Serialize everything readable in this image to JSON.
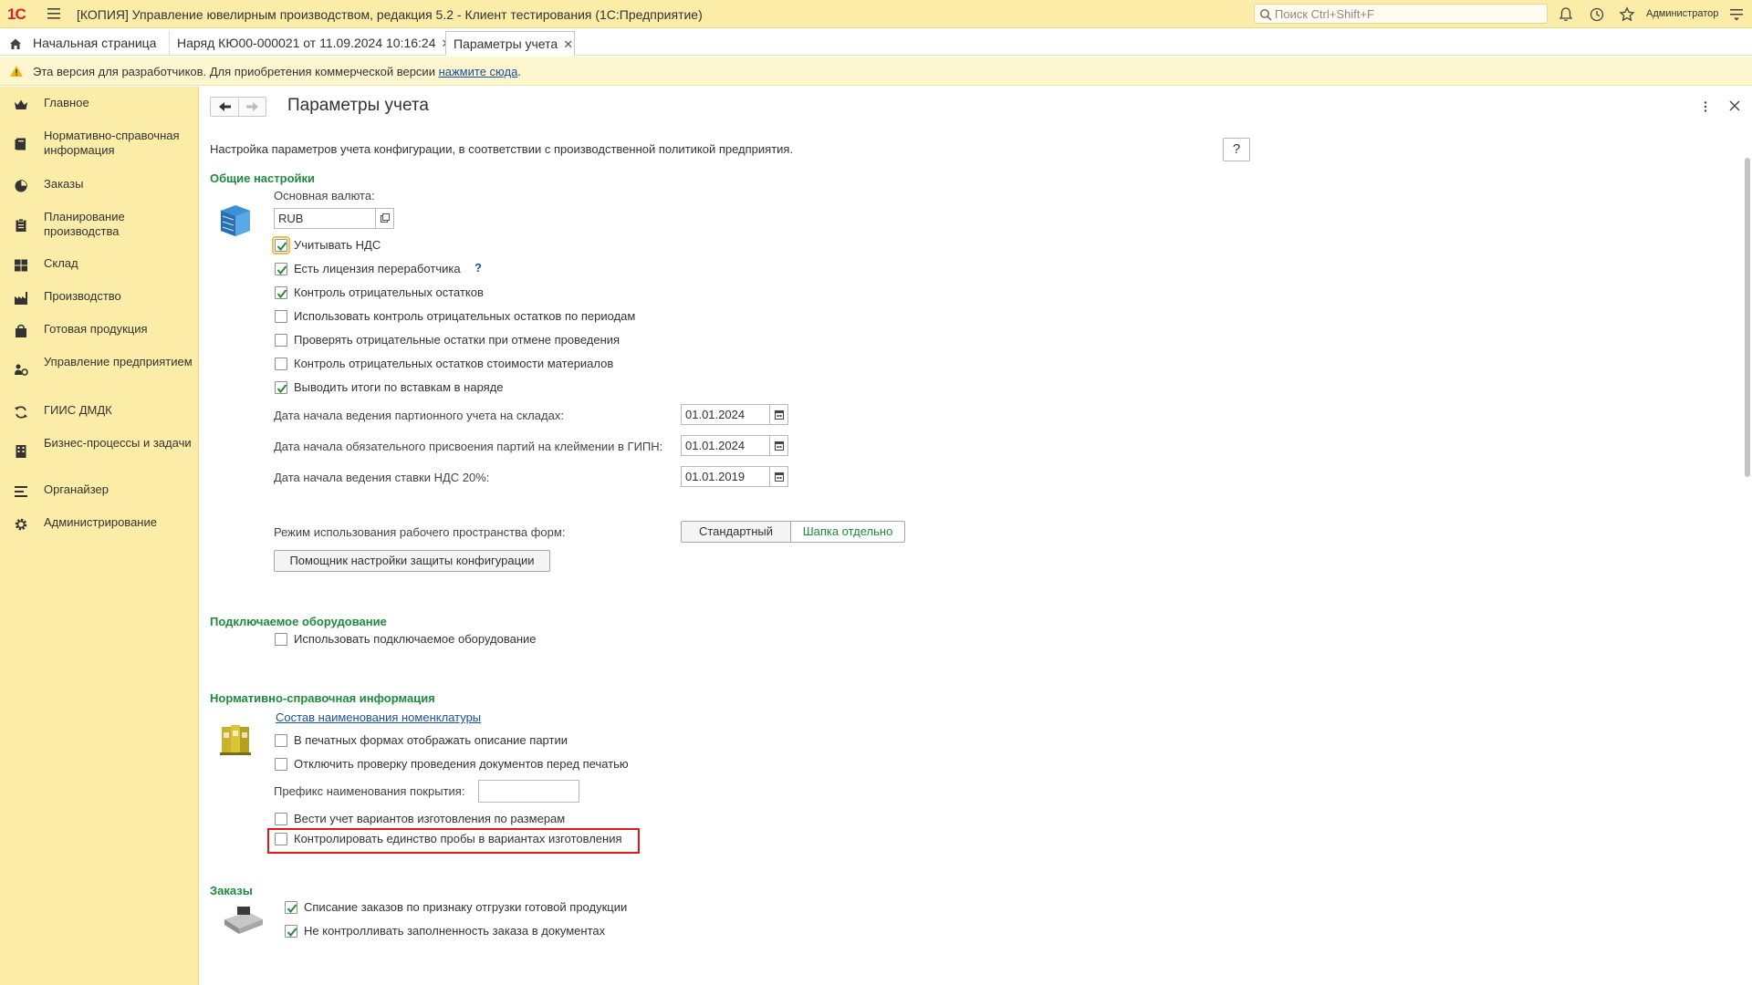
{
  "titlebar": {
    "logo": "1С",
    "app_title": "[КОПИЯ] Управление ювелирным производством, редакция 5.2  - Клиент тестирования (1С:Предприятие)",
    "search_placeholder": "Поиск Ctrl+Shift+F",
    "user": "Администратор"
  },
  "tabs": [
    {
      "label": "Начальная страница"
    },
    {
      "label": "Наряд КЮ00-000021 от 11.09.2024 10:16:24"
    },
    {
      "label": "Параметры учета"
    }
  ],
  "notice": {
    "text": "Эта версия для разработчиков. Для приобретения коммерческой версии ",
    "link": "нажмите сюда",
    "suffix": "."
  },
  "sidebar": {
    "items": [
      {
        "label": "Главное",
        "icon": "crown-icon"
      },
      {
        "label": "Нормативно-справочная информация",
        "icon": "book-icon"
      },
      {
        "label": "Заказы",
        "icon": "pie-chart-icon"
      },
      {
        "label": "Планирование производства",
        "icon": "clipboard-icon"
      },
      {
        "label": "Склад",
        "icon": "grid-icon"
      },
      {
        "label": "Производство",
        "icon": "factory-icon"
      },
      {
        "label": "Готовая продукция",
        "icon": "bag-icon"
      },
      {
        "label": "Управление предприятием",
        "icon": "people-gear-icon"
      },
      {
        "label": "ГИИС ДМДК",
        "icon": "sync-icon"
      },
      {
        "label": "Бизнес-процессы и задачи",
        "icon": "building-icon"
      },
      {
        "label": "Органайзер",
        "icon": "list-icon"
      },
      {
        "label": "Администрирование",
        "icon": "gear-icon"
      }
    ]
  },
  "page": {
    "title": "Параметры учета",
    "description": "Настройка параметров учета конфигурации, в соответствии с производственной политикой предприятия.",
    "help": "?"
  },
  "general": {
    "title": "Общие настройки",
    "currency_label": "Основная валюта:",
    "currency_value": "RUB",
    "checkboxes": [
      {
        "label": "Учитывать НДС",
        "checked": true
      },
      {
        "label": "Есть лицензия переработчика",
        "checked": true
      },
      {
        "label": "Контроль отрицательных остатков",
        "checked": true
      },
      {
        "label": "Использовать контроль отрицательных остатков по периодам",
        "checked": false
      },
      {
        "label": "Проверять отрицательные остатки при отмене проведения",
        "checked": false
      },
      {
        "label": "Контроль отрицательных остатков стоимости материалов",
        "checked": false
      },
      {
        "label": "Выводить итоги по вставкам в наряде",
        "checked": true
      }
    ],
    "license_help": "?",
    "dates": [
      {
        "label": "Дата начала ведения партионного учета на складах:",
        "value": "01.01.2024"
      },
      {
        "label": "Дата начала обязательного присвоения партий на клеймении в ГИПН:",
        "value": "01.01.2024"
      },
      {
        "label": "Дата начала ведения ставки НДС 20%:",
        "value": "01.01.2019"
      }
    ],
    "workspace_label": "Режим использования рабочего пространства форм:",
    "workspace_options": [
      "Стандартный",
      "Шапка отдельно"
    ],
    "workspace_selected": "Шапка отдельно",
    "protection_button": "Помощник настройки защиты конфигурации"
  },
  "equipment": {
    "title": "Подключаемое оборудование",
    "checkbox": {
      "label": "Использовать подключаемое оборудование",
      "checked": false
    }
  },
  "nsi": {
    "title": "Нормативно-справочная информация",
    "link": "Состав наименования номенклатуры",
    "checkboxes": [
      {
        "label": "В печатных формах отображать описание партии",
        "checked": false
      },
      {
        "label": "Отключить проверку проведения документов перед печатью",
        "checked": false
      }
    ],
    "prefix_label": "Префикс наименования покрытия:",
    "prefix_value": "",
    "checkboxes2": [
      {
        "label": "Вести учет вариантов изготовления по размерам",
        "checked": false
      },
      {
        "label": "Контролировать единство пробы в вариантах изготовления",
        "checked": false
      }
    ]
  },
  "orders": {
    "title": "Заказы",
    "checkboxes": [
      {
        "label": "Списание заказов по признаку отгрузки готовой продукции",
        "checked": true
      },
      {
        "label": "Не контролливать заполненность заказа в документах",
        "checked": true
      }
    ]
  },
  "colors": {
    "accent_green": "#1d8a3e",
    "panel_yellow": "#fbeca7",
    "highlight_red": "#e01818",
    "link_blue": "#1a4f9c"
  }
}
